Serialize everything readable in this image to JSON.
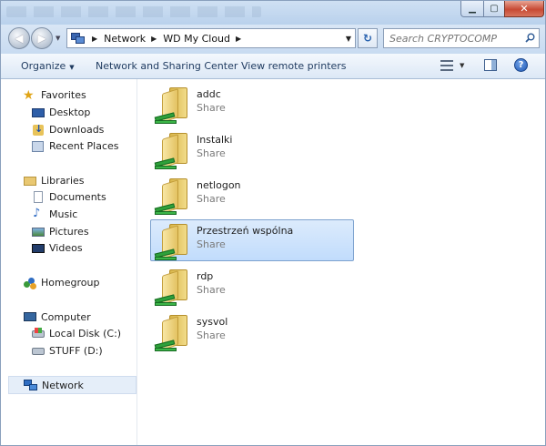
{
  "window": {
    "minimize_glyph": "▁",
    "maximize_glyph": "▢",
    "close_glyph": "✕"
  },
  "address_bar": {
    "breadcrumbs": [
      "Network",
      "WD My Cloud"
    ],
    "separator": "▶",
    "dropdown_glyph": "▼",
    "refresh_glyph": "↻"
  },
  "search": {
    "placeholder": "Search CRYPTOCOMP",
    "icon": "magnifier-icon"
  },
  "nav_buttons": {
    "back_glyph": "◀",
    "forward_glyph": "▶",
    "history_glyph": "▼"
  },
  "command_bar": {
    "organize": "Organize",
    "organize_arrow": "▼",
    "network_sharing_center": "Network and Sharing Center",
    "view_remote_printers": "View remote printers",
    "view_arrow": "▼",
    "help_glyph": "?"
  },
  "nav_pane": {
    "favorites": {
      "label": "Favorites",
      "items": [
        "Desktop",
        "Downloads",
        "Recent Places"
      ]
    },
    "libraries": {
      "label": "Libraries",
      "items": [
        "Documents",
        "Music",
        "Pictures",
        "Videos"
      ]
    },
    "homegroup": "Homegroup",
    "computer": {
      "label": "Computer",
      "items": [
        "Local Disk (C:)",
        "STUFF (D:)"
      ]
    },
    "network": "Network",
    "star_glyph": "★",
    "music_glyph": "♪"
  },
  "shares": [
    {
      "name": "addc",
      "type": "Share",
      "selected": false
    },
    {
      "name": "Instalki",
      "type": "Share",
      "selected": false
    },
    {
      "name": "netlogon",
      "type": "Share",
      "selected": false
    },
    {
      "name": "Przestrzeń wspólna",
      "type": "Share",
      "selected": true
    },
    {
      "name": "rdp",
      "type": "Share",
      "selected": false
    },
    {
      "name": "sysvol",
      "type": "Share",
      "selected": false
    }
  ],
  "colors": {
    "accent": "#2b64b0",
    "selection": "#c1dcfc",
    "folder": "#e3c262",
    "share_pipe": "#2ea13a"
  }
}
